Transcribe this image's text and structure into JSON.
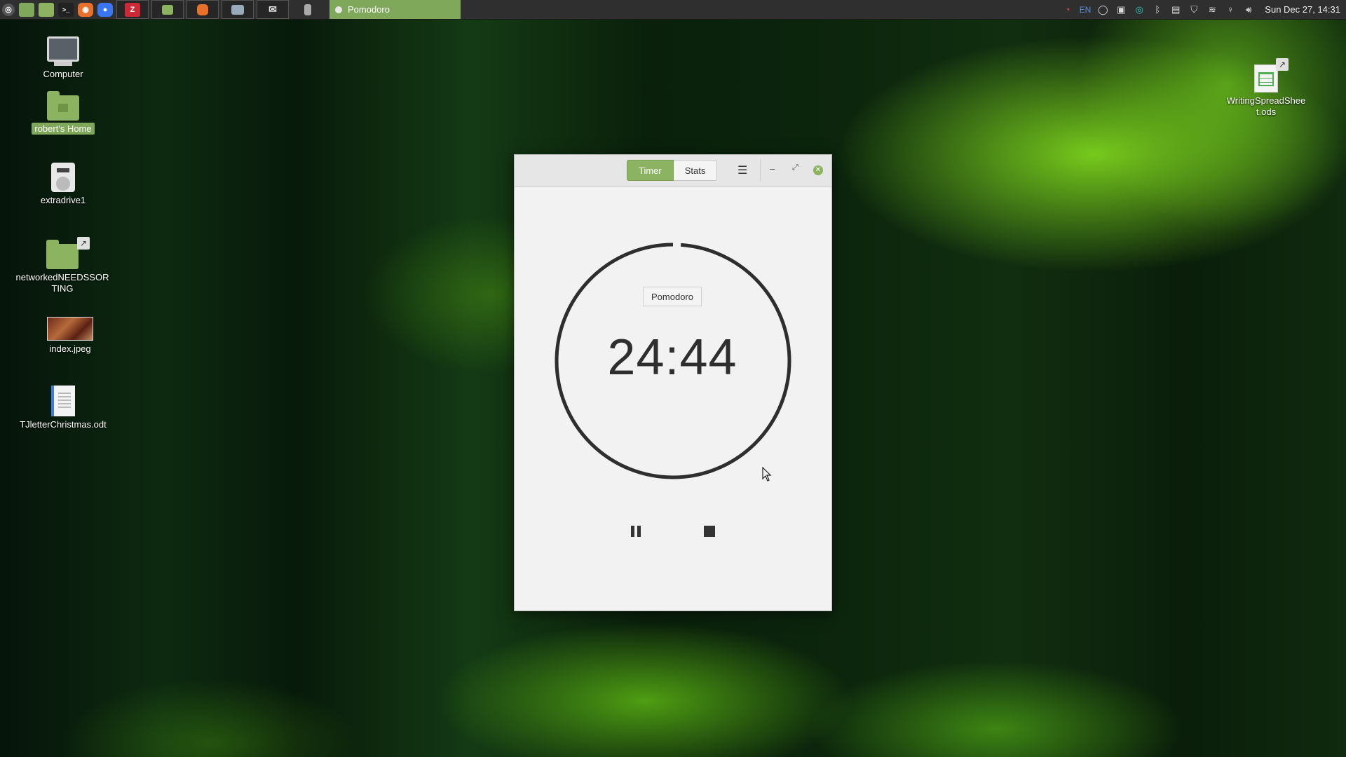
{
  "taskbar": {
    "launchers": [
      {
        "icon": "mint-menu-icon",
        "glyph": "◎",
        "color": "#555"
      },
      {
        "icon": "show-desktop-icon",
        "glyph": "",
        "color": "#7fa85a"
      },
      {
        "icon": "file-manager-icon",
        "glyph": "",
        "color": "#8cb35f"
      },
      {
        "icon": "terminal-icon",
        "glyph": ">_",
        "color": "#222"
      },
      {
        "icon": "firefox-icon",
        "glyph": "◉",
        "color": "#e8702a"
      },
      {
        "icon": "signal-icon",
        "glyph": "●",
        "color": "#3a76f0"
      }
    ],
    "windows": [
      {
        "icon": "zotero-icon",
        "glyph": "Z",
        "color": "#cc2936"
      },
      {
        "icon": "files-window-icon",
        "glyph": "▭",
        "color": "#8cb35f"
      },
      {
        "icon": "firefox-window-icon",
        "glyph": "◉",
        "color": "#e8702a"
      },
      {
        "icon": "screenshot-window-icon",
        "glyph": "▣",
        "color": "#9ab"
      },
      {
        "icon": "mail-window-icon",
        "glyph": "✉",
        "color": "#ddd"
      },
      {
        "icon": "document-window-icon",
        "glyph": "▯",
        "color": "#aaa"
      }
    ],
    "active_window": "Pomodoro",
    "tray": {
      "lang": "EN",
      "clock": "Sun Dec 27, 14:31"
    }
  },
  "desktop": {
    "icons": [
      {
        "label": "Computer"
      },
      {
        "label": "robert's Home"
      },
      {
        "label": "extradrive1"
      },
      {
        "label": "networkedNEEDSSORTING"
      },
      {
        "label": "index.jpeg"
      },
      {
        "label": "TJletterChristmas.odt"
      },
      {
        "label": "WritingSpreadSheet.ods"
      }
    ]
  },
  "pomodoro": {
    "tabs": {
      "timer": "Timer",
      "stats": "Stats"
    },
    "mode": "Pomodoro",
    "time": "24:44",
    "progress_fraction": 0.0107
  },
  "colors": {
    "accent": "#8bb362",
    "ring": "#2e2e2e"
  }
}
